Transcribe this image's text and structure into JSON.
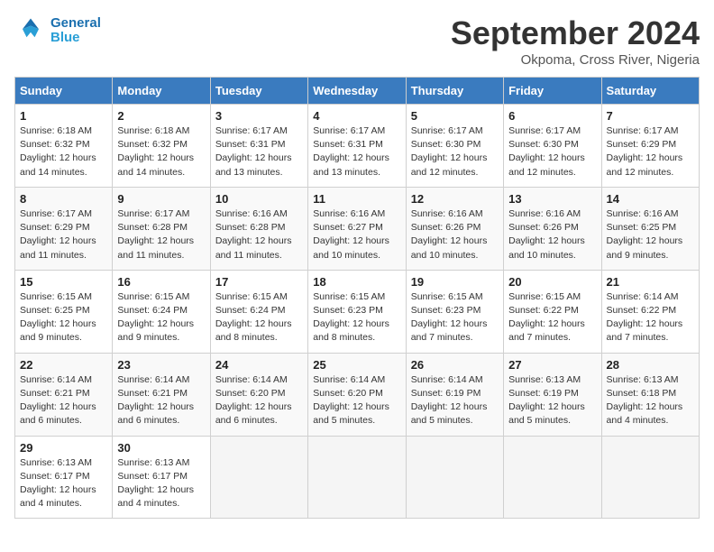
{
  "logo": {
    "line1": "General",
    "line2": "Blue"
  },
  "title": "September 2024",
  "subtitle": "Okpoma, Cross River, Nigeria",
  "days_of_week": [
    "Sunday",
    "Monday",
    "Tuesday",
    "Wednesday",
    "Thursday",
    "Friday",
    "Saturday"
  ],
  "weeks": [
    [
      {
        "day": "1",
        "sunrise": "6:18 AM",
        "sunset": "6:32 PM",
        "daylight": "12 hours and 14 minutes."
      },
      {
        "day": "2",
        "sunrise": "6:18 AM",
        "sunset": "6:32 PM",
        "daylight": "12 hours and 14 minutes."
      },
      {
        "day": "3",
        "sunrise": "6:17 AM",
        "sunset": "6:31 PM",
        "daylight": "12 hours and 13 minutes."
      },
      {
        "day": "4",
        "sunrise": "6:17 AM",
        "sunset": "6:31 PM",
        "daylight": "12 hours and 13 minutes."
      },
      {
        "day": "5",
        "sunrise": "6:17 AM",
        "sunset": "6:30 PM",
        "daylight": "12 hours and 12 minutes."
      },
      {
        "day": "6",
        "sunrise": "6:17 AM",
        "sunset": "6:30 PM",
        "daylight": "12 hours and 12 minutes."
      },
      {
        "day": "7",
        "sunrise": "6:17 AM",
        "sunset": "6:29 PM",
        "daylight": "12 hours and 12 minutes."
      }
    ],
    [
      {
        "day": "8",
        "sunrise": "6:17 AM",
        "sunset": "6:29 PM",
        "daylight": "12 hours and 11 minutes."
      },
      {
        "day": "9",
        "sunrise": "6:17 AM",
        "sunset": "6:28 PM",
        "daylight": "12 hours and 11 minutes."
      },
      {
        "day": "10",
        "sunrise": "6:16 AM",
        "sunset": "6:28 PM",
        "daylight": "12 hours and 11 minutes."
      },
      {
        "day": "11",
        "sunrise": "6:16 AM",
        "sunset": "6:27 PM",
        "daylight": "12 hours and 10 minutes."
      },
      {
        "day": "12",
        "sunrise": "6:16 AM",
        "sunset": "6:26 PM",
        "daylight": "12 hours and 10 minutes."
      },
      {
        "day": "13",
        "sunrise": "6:16 AM",
        "sunset": "6:26 PM",
        "daylight": "12 hours and 10 minutes."
      },
      {
        "day": "14",
        "sunrise": "6:16 AM",
        "sunset": "6:25 PM",
        "daylight": "12 hours and 9 minutes."
      }
    ],
    [
      {
        "day": "15",
        "sunrise": "6:15 AM",
        "sunset": "6:25 PM",
        "daylight": "12 hours and 9 minutes."
      },
      {
        "day": "16",
        "sunrise": "6:15 AM",
        "sunset": "6:24 PM",
        "daylight": "12 hours and 9 minutes."
      },
      {
        "day": "17",
        "sunrise": "6:15 AM",
        "sunset": "6:24 PM",
        "daylight": "12 hours and 8 minutes."
      },
      {
        "day": "18",
        "sunrise": "6:15 AM",
        "sunset": "6:23 PM",
        "daylight": "12 hours and 8 minutes."
      },
      {
        "day": "19",
        "sunrise": "6:15 AM",
        "sunset": "6:23 PM",
        "daylight": "12 hours and 7 minutes."
      },
      {
        "day": "20",
        "sunrise": "6:15 AM",
        "sunset": "6:22 PM",
        "daylight": "12 hours and 7 minutes."
      },
      {
        "day": "21",
        "sunrise": "6:14 AM",
        "sunset": "6:22 PM",
        "daylight": "12 hours and 7 minutes."
      }
    ],
    [
      {
        "day": "22",
        "sunrise": "6:14 AM",
        "sunset": "6:21 PM",
        "daylight": "12 hours and 6 minutes."
      },
      {
        "day": "23",
        "sunrise": "6:14 AM",
        "sunset": "6:21 PM",
        "daylight": "12 hours and 6 minutes."
      },
      {
        "day": "24",
        "sunrise": "6:14 AM",
        "sunset": "6:20 PM",
        "daylight": "12 hours and 6 minutes."
      },
      {
        "day": "25",
        "sunrise": "6:14 AM",
        "sunset": "6:20 PM",
        "daylight": "12 hours and 5 minutes."
      },
      {
        "day": "26",
        "sunrise": "6:14 AM",
        "sunset": "6:19 PM",
        "daylight": "12 hours and 5 minutes."
      },
      {
        "day": "27",
        "sunrise": "6:13 AM",
        "sunset": "6:19 PM",
        "daylight": "12 hours and 5 minutes."
      },
      {
        "day": "28",
        "sunrise": "6:13 AM",
        "sunset": "6:18 PM",
        "daylight": "12 hours and 4 minutes."
      }
    ],
    [
      {
        "day": "29",
        "sunrise": "6:13 AM",
        "sunset": "6:17 PM",
        "daylight": "12 hours and 4 minutes."
      },
      {
        "day": "30",
        "sunrise": "6:13 AM",
        "sunset": "6:17 PM",
        "daylight": "12 hours and 4 minutes."
      },
      null,
      null,
      null,
      null,
      null
    ]
  ],
  "labels": {
    "sunrise": "Sunrise: ",
    "sunset": "Sunset: ",
    "daylight": "Daylight: "
  }
}
